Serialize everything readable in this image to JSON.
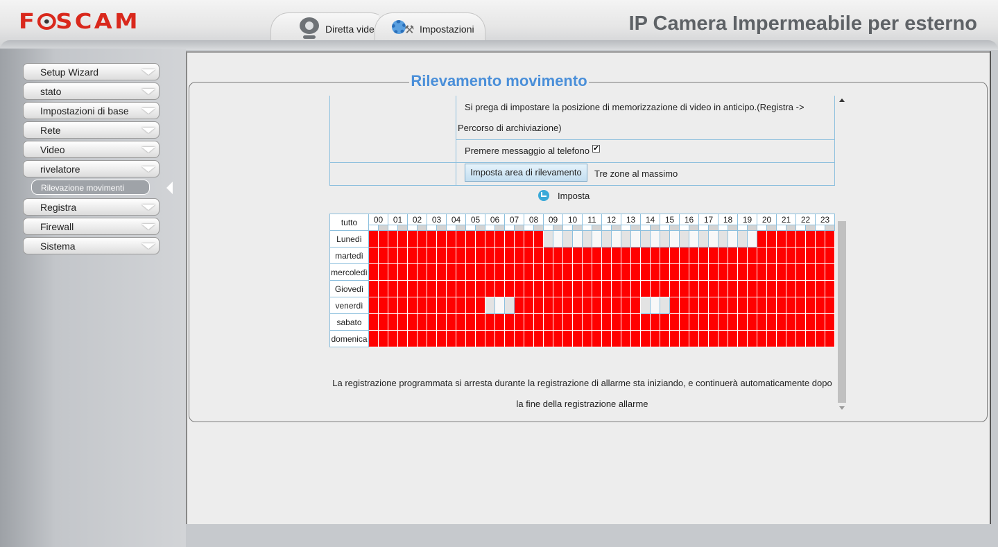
{
  "header": {
    "logo": "FOSCAM",
    "product_title": "IP Camera Impermeabile per esterno",
    "tabs": [
      {
        "label": "Diretta video",
        "icon": "webcam-icon"
      },
      {
        "label": "Impostazioni",
        "icon": "gear-wrench-icon"
      }
    ]
  },
  "sidebar": {
    "items": [
      {
        "label": "Setup Wizard"
      },
      {
        "label": "stato"
      },
      {
        "label": "Impostazioni di base"
      },
      {
        "label": "Rete"
      },
      {
        "label": "Video"
      },
      {
        "label": "rivelatore"
      },
      {
        "label": "Registra"
      },
      {
        "label": "Firewall"
      },
      {
        "label": "Sistema"
      }
    ],
    "active_submenu": "Rilevazione movimenti"
  },
  "main": {
    "section_title": "Rilevamento movimento",
    "storage_note_line1": "Si prega di impostare la posizione di memorizzazione di video in anticipo.(Registra ->",
    "storage_note_line2": "Percorso di archiviazione)",
    "phone_message_label": "Premere messaggio al telefono",
    "phone_message_checked": true,
    "area_button": "Imposta area di rilevamento",
    "area_note": "Tre zone al massimo",
    "schedule_label": "Imposta",
    "footer_note_line1": "La registrazione programmata si arresta durante la registrazione di allarme sta iniziando, e continuerà automaticamente dopo",
    "footer_note_line2": "la fine della registrazione allarme"
  },
  "schedule": {
    "all_label": "tutto",
    "hours": [
      "00",
      "01",
      "02",
      "03",
      "04",
      "05",
      "06",
      "07",
      "08",
      "09",
      "10",
      "11",
      "12",
      "13",
      "14",
      "15",
      "16",
      "17",
      "18",
      "19",
      "20",
      "21",
      "22",
      "23"
    ],
    "days": [
      {
        "name": "Lunedì",
        "off_slots": [
          18,
          19,
          20,
          21,
          22,
          23,
          24,
          25,
          26,
          27,
          28,
          29,
          30,
          31,
          32,
          33,
          34,
          35,
          36,
          37,
          38,
          39
        ]
      },
      {
        "name": "martedì",
        "off_slots": []
      },
      {
        "name": "mercoledì",
        "off_slots": []
      },
      {
        "name": "Giovedì",
        "off_slots": []
      },
      {
        "name": "venerdì",
        "off_slots": [
          12,
          13,
          14,
          28,
          29,
          30
        ]
      },
      {
        "name": "sabato",
        "off_slots": []
      },
      {
        "name": "domenica",
        "off_slots": []
      }
    ],
    "colors": {
      "selected": "#ff0000",
      "unselected": "#e3e3e3"
    }
  }
}
